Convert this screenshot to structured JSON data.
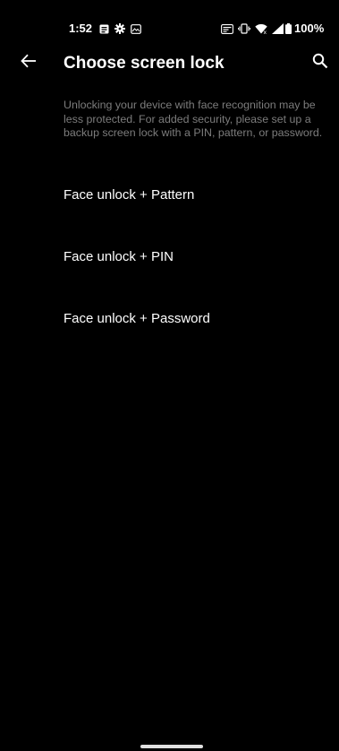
{
  "status_bar": {
    "time": "1:52",
    "battery_percent": "100%",
    "icons": [
      "notes-icon",
      "gear-icon",
      "image-icon",
      "data-saver-icon",
      "vibrate-icon",
      "wifi-icon",
      "signal-icon",
      "battery-icon"
    ]
  },
  "app_bar": {
    "title": "Choose screen lock",
    "back_icon": "arrow-left-icon",
    "search_icon": "search-icon"
  },
  "description": "Unlocking your device with face recognition may be less protected. For added security, please set up a backup screen lock with a PIN, pattern, or password.",
  "options": [
    {
      "label": "Face unlock + Pattern"
    },
    {
      "label": "Face unlock + PIN"
    },
    {
      "label": "Face unlock + Password"
    }
  ],
  "colors": {
    "background": "#000000",
    "text_primary": "#ffffff",
    "text_secondary": "#7c7c7c"
  }
}
